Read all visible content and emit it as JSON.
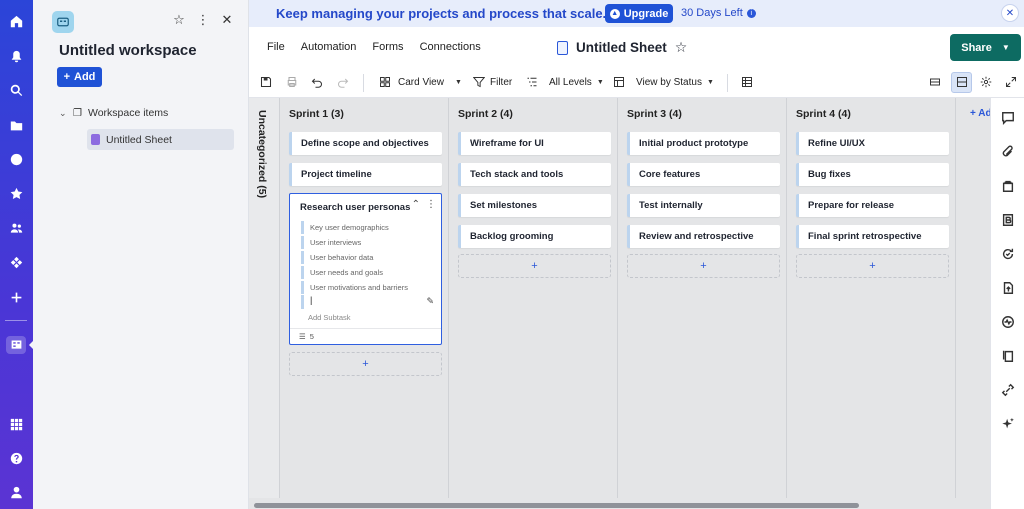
{
  "banner": {
    "message": "Keep managing your projects and process that scale.",
    "upgrade_label": "Upgrade",
    "days_left": "30 Days Left"
  },
  "sidebar": {
    "workspace_title": "Untitled workspace",
    "add_label": "Add",
    "tree": {
      "group_label": "Workspace items",
      "child_label": "Untitled Sheet"
    }
  },
  "menu": {
    "items": [
      "File",
      "Automation",
      "Forms",
      "Connections"
    ],
    "sheet_title": "Untitled Sheet",
    "share_label": "Share"
  },
  "toolbar": {
    "view_label": "Card View",
    "filter_label": "Filter",
    "levels_label": "All Levels",
    "status_label": "View by Status"
  },
  "board": {
    "uncategorized_label": "Uncategorized (5)",
    "add_column_label": "+ Ad",
    "columns": [
      {
        "title": "Sprint 1 (3)",
        "cards": [
          "Define scope and objectives",
          "Project timeline"
        ],
        "expanded_card": {
          "title": "Research user personas",
          "subtasks": [
            "Key user demographics",
            "User interviews",
            "User behavior data",
            "User needs and goals",
            "User motivations and barriers"
          ],
          "input_value": "|",
          "add_subtask_label": "Add Subtask",
          "subtask_count": "5"
        }
      },
      {
        "title": "Sprint 2 (4)",
        "cards": [
          "Wireframe for UI",
          "Tech stack and tools",
          "Set milestones",
          "Backlog grooming"
        ]
      },
      {
        "title": "Sprint 3 (4)",
        "cards": [
          "Initial product prototype",
          "Core features",
          "Test internally",
          "Review and retrospective"
        ]
      },
      {
        "title": "Sprint 4 (4)",
        "cards": [
          "Refine UI/UX",
          "Bug fixes",
          "Prepare for release",
          "Final sprint retrospective"
        ]
      }
    ],
    "add_card_label": "+"
  },
  "colors": {
    "accent": "#1f52d6",
    "share": "#0d6b62",
    "rail": "#3b3fd6",
    "card_stripe": "#bcd4ee"
  }
}
